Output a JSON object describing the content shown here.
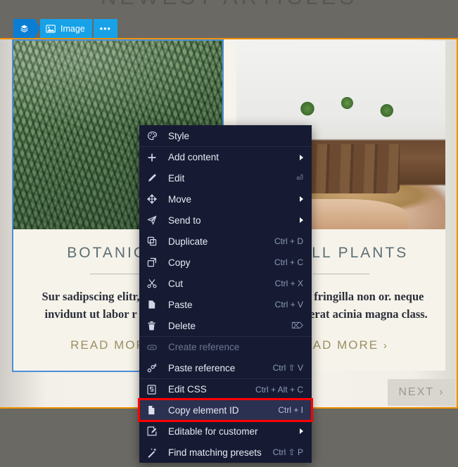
{
  "site": {
    "heading": "NEWEST ARTICLES",
    "next_button": {
      "label": "NEXT",
      "chevron": "›"
    },
    "cards": [
      {
        "photo": "palm-fronds-photo",
        "title": "BOTANICAL",
        "text": "Sur sadipscing elitr, no tempor invidunt ut labor r invidunt u",
        "link": "READ MORE",
        "link_chevron": "›",
        "selected": true
      },
      {
        "photo": "seedling-pots-photo",
        "title": "SMALL PLANTS",
        "text": "risus? Non fringilla non or. neque purus, placerat acinia magna class.",
        "link": "READ MORE",
        "link_chevron": "›",
        "selected": false
      }
    ]
  },
  "toolbar": {
    "parent_badge": {
      "icon": "layers-icon",
      "label": ""
    },
    "element_badge": {
      "icon": "image-icon",
      "label": "Image"
    },
    "more_badge": {
      "label": "•••"
    }
  },
  "context_menu": {
    "items": [
      {
        "icon": "palette-icon",
        "label": "Style",
        "shortcut": "",
        "submenu": false,
        "disabled": false,
        "separator": false,
        "highlighted": false
      },
      {
        "icon": "plus-icon",
        "label": "Add content",
        "shortcut": "",
        "submenu": true,
        "disabled": false,
        "separator": true,
        "highlighted": false
      },
      {
        "icon": "pencil-icon",
        "label": "Edit",
        "shortcut": "⏎",
        "submenu": false,
        "disabled": false,
        "separator": false,
        "highlighted": false
      },
      {
        "icon": "move-icon",
        "label": "Move",
        "shortcut": "",
        "submenu": true,
        "disabled": false,
        "separator": false,
        "highlighted": false
      },
      {
        "icon": "send-to-icon",
        "label": "Send to",
        "shortcut": "",
        "submenu": true,
        "disabled": false,
        "separator": false,
        "highlighted": false
      },
      {
        "icon": "duplicate-icon",
        "label": "Duplicate",
        "shortcut": "Ctrl + D",
        "submenu": false,
        "disabled": false,
        "separator": false,
        "highlighted": false
      },
      {
        "icon": "copy-icon",
        "label": "Copy",
        "shortcut": "Ctrl + C",
        "submenu": false,
        "disabled": false,
        "separator": false,
        "highlighted": false
      },
      {
        "icon": "cut-icon",
        "label": "Cut",
        "shortcut": "Ctrl + X",
        "submenu": false,
        "disabled": false,
        "separator": false,
        "highlighted": false
      },
      {
        "icon": "paste-icon",
        "label": "Paste",
        "shortcut": "Ctrl + V",
        "submenu": false,
        "disabled": false,
        "separator": false,
        "highlighted": false
      },
      {
        "icon": "trash-icon",
        "label": "Delete",
        "shortcut": "⌦",
        "submenu": false,
        "disabled": false,
        "separator": false,
        "highlighted": false
      },
      {
        "icon": "link-icon",
        "label": "Create reference",
        "shortcut": "",
        "submenu": false,
        "disabled": true,
        "separator": true,
        "highlighted": false
      },
      {
        "icon": "paste-reference-icon",
        "label": "Paste reference",
        "shortcut": "Ctrl ⇧ V",
        "submenu": false,
        "disabled": false,
        "separator": false,
        "highlighted": false
      },
      {
        "icon": "css-icon",
        "label": "Edit CSS",
        "shortcut": "Ctrl + Alt + C",
        "submenu": false,
        "disabled": false,
        "separator": true,
        "highlighted": false
      },
      {
        "icon": "element-id-icon",
        "label": "Copy element ID",
        "shortcut": "Ctrl + I",
        "submenu": false,
        "disabled": false,
        "separator": false,
        "highlighted": true
      },
      {
        "icon": "editable-customer-icon",
        "label": "Editable for customer",
        "shortcut": "",
        "submenu": true,
        "disabled": false,
        "separator": false,
        "highlighted": false
      },
      {
        "icon": "magic-wand-icon",
        "label": "Find matching presets",
        "shortcut": "Ctrl ⇧ P",
        "submenu": false,
        "disabled": false,
        "separator": false,
        "highlighted": false
      }
    ]
  },
  "colors": {
    "selection_orange": "#f09000",
    "selection_blue": "#4a90d9",
    "badge_blue": "#17a2e8",
    "badge_blue_dark": "#0b7ed4",
    "menu_bg": "#161b33",
    "highlight_red": "#ff0000"
  }
}
